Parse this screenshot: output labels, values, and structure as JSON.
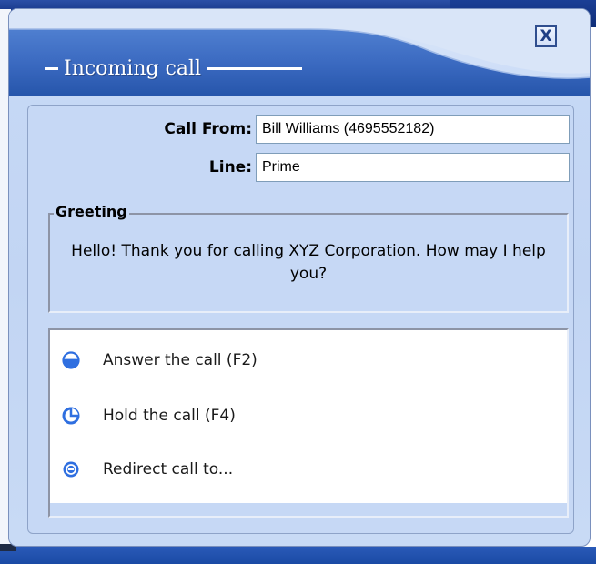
{
  "dialog": {
    "title": "Incoming call",
    "close_label": "X"
  },
  "fields": {
    "call_from": {
      "label": "Call From:",
      "value": "Bill Williams (4695552182)"
    },
    "line": {
      "label": "Line:",
      "value": "Prime"
    }
  },
  "greeting": {
    "legend": "Greeting",
    "text": "Hello! Thank you for calling XYZ Corporation. How may I help you?"
  },
  "options": [
    {
      "label": "Answer the call (F2)",
      "icon": "answer-call-icon"
    },
    {
      "label": "Hold the call (F4)",
      "icon": "hold-call-icon"
    },
    {
      "label": "Redirect call to...",
      "icon": "redirect-call-icon"
    }
  ],
  "colors": {
    "header_blue": "#2f5eb8",
    "panel_background": "#c6d8f5",
    "icon_blue": "#2f6fe0"
  }
}
